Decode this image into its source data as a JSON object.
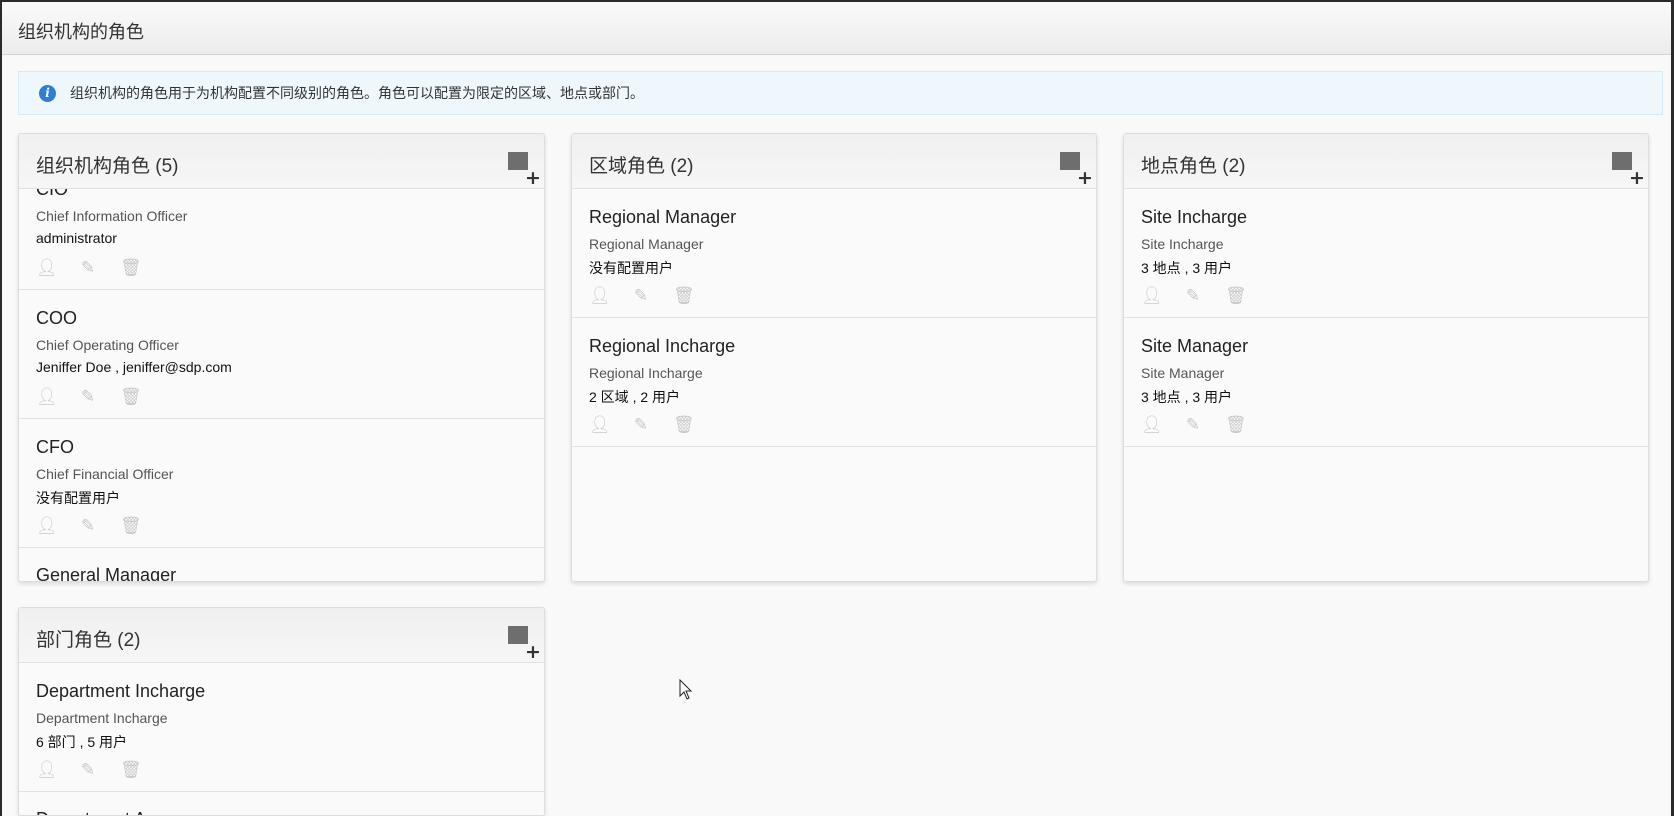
{
  "header": {
    "title": "组织机构的角色"
  },
  "info": {
    "text": "组织机构的角色用于为机构配置不同级别的角色。角色可以配置为限定的区域、地点或部门。"
  },
  "cards": [
    {
      "title": "组织机构角色 (5)",
      "items": [
        {
          "title": "CIO",
          "subtitle": "Chief Information Officer",
          "detail": "administrator"
        },
        {
          "title": "COO",
          "subtitle": "Chief Operating Officer",
          "detail": "Jeniffer Doe , jeniffer@sdp.com"
        },
        {
          "title": "CFO",
          "subtitle": "Chief Financial Officer",
          "detail": "没有配置用户"
        },
        {
          "title": "General Manager",
          "subtitle": "",
          "detail": ""
        }
      ]
    },
    {
      "title": "区域角色 (2)",
      "items": [
        {
          "title": "Regional Manager",
          "subtitle": "Regional Manager",
          "detail": "没有配置用户"
        },
        {
          "title": "Regional Incharge",
          "subtitle": "Regional Incharge",
          "detail": "2 区域 , 2 用户"
        }
      ]
    },
    {
      "title": "地点角色 (2)",
      "items": [
        {
          "title": "Site Incharge",
          "subtitle": "Site Incharge",
          "detail": "3 地点 , 3 用户"
        },
        {
          "title": "Site Manager",
          "subtitle": "Site Manager",
          "detail": "3 地点 , 3 用户"
        }
      ]
    },
    {
      "title": "部门角色 (2)",
      "items": [
        {
          "title": "Department Incharge",
          "subtitle": "Department Incharge",
          "detail": "6 部门 , 5 用户"
        },
        {
          "title": "Department A",
          "subtitle": "",
          "detail": ""
        }
      ]
    }
  ],
  "icons": {
    "add": "plus-icon",
    "assign": "user-icon",
    "edit": "edit-icon",
    "delete": "trash-icon"
  }
}
